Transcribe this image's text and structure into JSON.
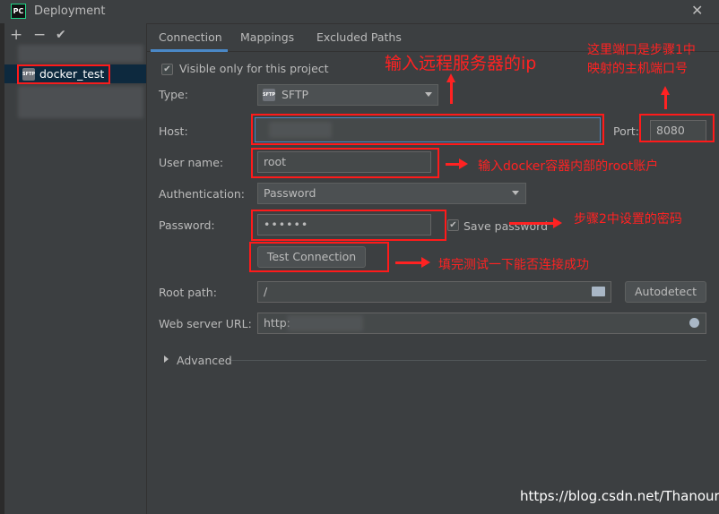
{
  "window": {
    "title": "Deployment",
    "logo": "PC"
  },
  "toolbar": {
    "add": "+",
    "remove": "−",
    "apply": "✔"
  },
  "servers": [
    {
      "label": "docker_test",
      "icon": "sftp-icon"
    }
  ],
  "tabs": [
    {
      "label": "Connection",
      "active": true
    },
    {
      "label": "Mappings"
    },
    {
      "label": "Excluded Paths"
    }
  ],
  "connection": {
    "visible_only_label": "Visible only for this project",
    "type_label": "Type:",
    "type_value": "SFTP",
    "host_label": "Host:",
    "port_label": "Port:",
    "port_value": "8080",
    "username_label": "User name:",
    "username_value": "root",
    "auth_label": "Authentication:",
    "auth_value": "Password",
    "password_label": "Password:",
    "password_value": "••••••",
    "save_password_label": "Save password",
    "test_connection_label": "Test Connection",
    "root_path_label": "Root path:",
    "root_path_value": "/",
    "autodetect_label": "Autodetect",
    "web_url_label": "Web server URL:",
    "web_url_value": "http:",
    "advanced_label": "Advanced"
  },
  "annotations": {
    "host_note": "输入远程服务器的ip",
    "port_note_1": "这里端口是步骤1中",
    "port_note_2": "映射的主机端口号",
    "user_note": "输入docker容器内部的root账户",
    "password_note": "步骤2中设置的密码",
    "test_note": "填完测试一下能否连接成功"
  },
  "watermark": "https://blog.csdn.net/Thanours"
}
